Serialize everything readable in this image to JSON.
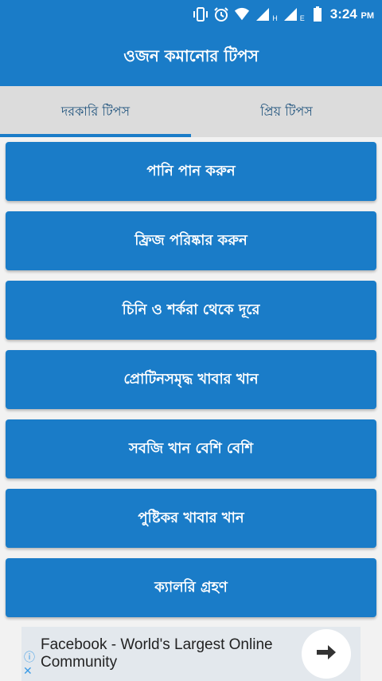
{
  "status_bar": {
    "time": "3:24",
    "ampm": "PM",
    "network_1": "H",
    "network_2": "E",
    "icons": [
      "vibrate-icon",
      "alarm-icon",
      "wifi-icon",
      "signal-icon",
      "signal-icon",
      "battery-icon"
    ]
  },
  "app_bar": {
    "title": "ওজন কমানোর টিপস"
  },
  "tabs": [
    {
      "label": "দরকারি টিপস",
      "active": true
    },
    {
      "label": "প্রিয় টিপস",
      "active": false
    }
  ],
  "tips": [
    {
      "label": "পানি পান করুন"
    },
    {
      "label": "ফ্রিজ পরিষ্কার করুন"
    },
    {
      "label": "চিনি ও শর্করা থেকে দূরে"
    },
    {
      "label": "প্রোটিনসমৃদ্ধ খাবার খান"
    },
    {
      "label": "সবজি খান বেশি বেশি"
    },
    {
      "label": "পুষ্টিকর খাবার খান"
    },
    {
      "label": "ক্যালরি গ্রহণ"
    }
  ],
  "ad": {
    "text": "Facebook - World's Largest Online Community",
    "cta_icon": "arrow-right-icon",
    "info_icon": "info-icon",
    "close_icon": "close-icon"
  },
  "colors": {
    "primary": "#1a7cc8",
    "tab_bg": "#dcdcdc",
    "background": "#f2f2f2",
    "ad_bg": "#e3e8ed"
  }
}
